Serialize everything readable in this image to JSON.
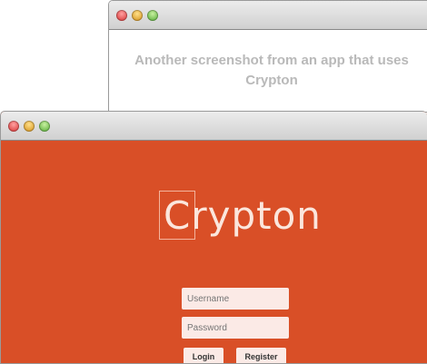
{
  "back_window": {
    "message": "Another screenshot from an app that uses Crypton"
  },
  "front_window": {
    "logo": "Crypton",
    "username_placeholder": "Username",
    "password_placeholder": "Password",
    "login_label": "Login",
    "register_label": "Register",
    "background": "#d94f27"
  }
}
